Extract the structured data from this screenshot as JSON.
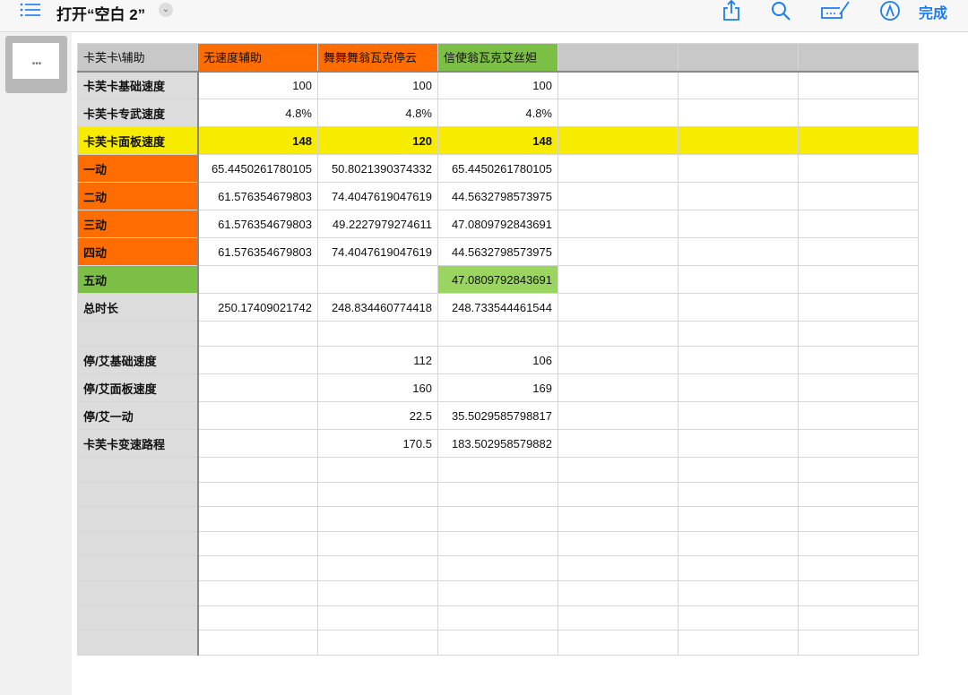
{
  "toolbar": {
    "title": "打开“空白 2”",
    "done": "完成"
  },
  "table": {
    "headers": [
      "卡芙卡\\辅助",
      "无速度辅助",
      "舞舞舞翁瓦克停云",
      "信使翁瓦克艾丝妲",
      "",
      "",
      ""
    ],
    "rows": [
      [
        "卡芙卡基础速度",
        "100",
        "100",
        "100"
      ],
      [
        "卡芙卡专武速度",
        "4.8%",
        "4.8%",
        "4.8%"
      ],
      [
        "卡芙卡面板速度",
        "148",
        "120",
        "148"
      ],
      [
        "一动",
        "65.4450261780105",
        "50.8021390374332",
        "65.4450261780105"
      ],
      [
        "二动",
        "61.576354679803",
        "74.4047619047619",
        "44.5632798573975"
      ],
      [
        "三动",
        "61.576354679803",
        "49.2227979274611",
        "47.0809792843691"
      ],
      [
        "四动",
        "61.576354679803",
        "74.4047619047619",
        "44.5632798573975"
      ],
      [
        "五动",
        "",
        "",
        "47.0809792843691"
      ],
      [
        "总时长",
        "250.17409021742",
        "248.834460774418",
        "248.733544461544"
      ],
      [
        "",
        "",
        "",
        ""
      ],
      [
        "停/艾基础速度",
        "",
        "112",
        "106"
      ],
      [
        "停/艾面板速度",
        "",
        "160",
        "169"
      ],
      [
        "停/艾一动",
        "",
        "22.5",
        "35.5029585798817"
      ],
      [
        "卡芙卡变速路程",
        "",
        "170.5",
        "183.502958579882"
      ]
    ],
    "blank_rows": 8
  }
}
